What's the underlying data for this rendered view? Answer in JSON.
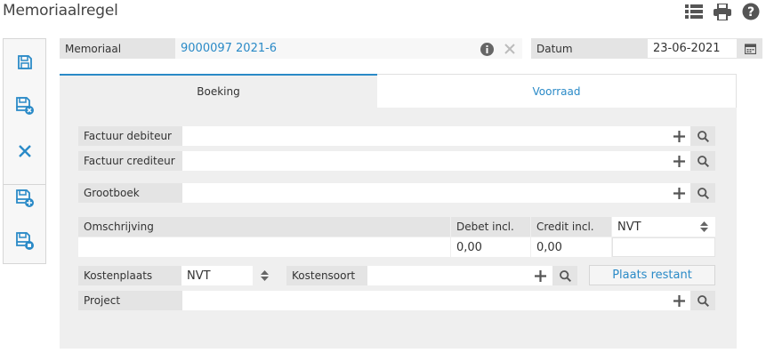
{
  "page": {
    "title": "Memoriaalregel"
  },
  "top_icons": [
    "list-icon",
    "print-icon",
    "help-icon"
  ],
  "sidebar": {
    "buttons": [
      "save-icon",
      "save-close-icon",
      "cancel-icon",
      "save-new-icon",
      "save-copy-icon"
    ]
  },
  "header": {
    "memoriaal_label": "Memoriaal",
    "memoriaal_value": "9000097 2021-6",
    "datum_label": "Datum",
    "datum_value": "23-06-2021"
  },
  "tabs": [
    {
      "label": "Boeking",
      "active": true
    },
    {
      "label": "Voorraad",
      "active": false
    }
  ],
  "form": {
    "factuur_debiteur_label": "Factuur debiteur",
    "factuur_debiteur_value": "",
    "factuur_crediteur_label": "Factuur crediteur",
    "factuur_crediteur_value": "",
    "grootboek_label": "Grootboek",
    "grootboek_value": "",
    "omschrijving_label": "Omschrijving",
    "omschrijving_value": "",
    "debet_label": "Debet incl.",
    "debet_value": "0,00",
    "credit_label": "Credit incl.",
    "credit_value": "0,00",
    "btw_value": "NVT",
    "kostenplaats_label": "Kostenplaats",
    "kostenplaats_value": "NVT",
    "kostensoort_label": "Kostensoort",
    "kostensoort_value": "",
    "plaats_restant_label": "Plaats restant",
    "project_label": "Project",
    "project_value": ""
  },
  "colors": {
    "accent": "#2a8ac7",
    "label_bg": "#e4e4e4",
    "panel_bg": "#efefef",
    "icon": "#555555"
  }
}
